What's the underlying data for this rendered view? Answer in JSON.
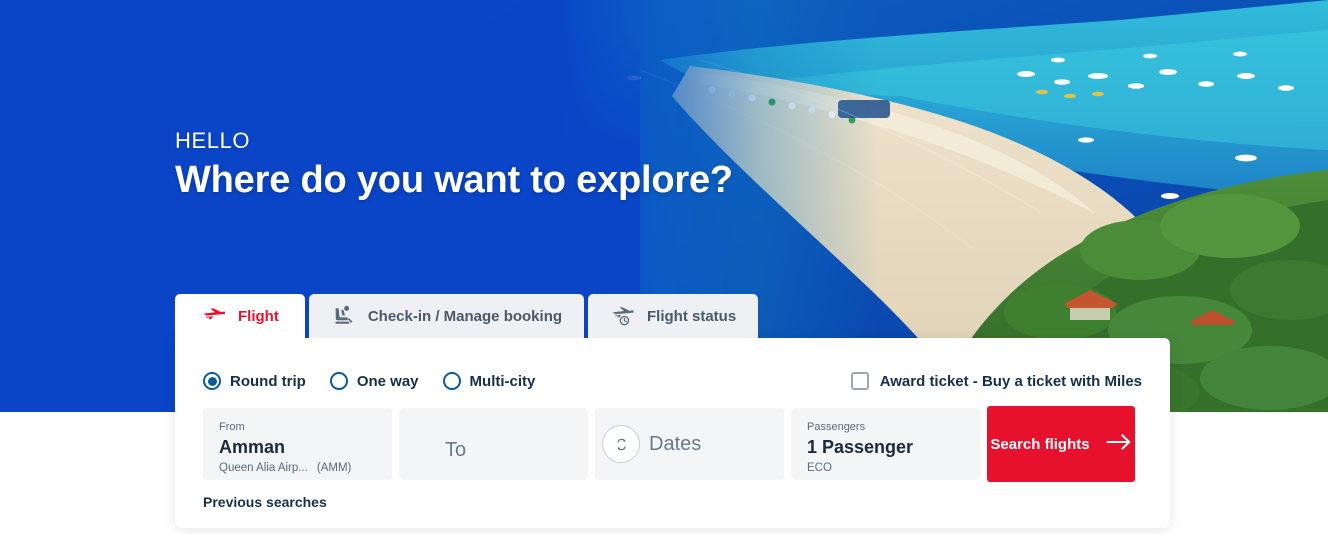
{
  "hero": {
    "greeting": "HELLO",
    "headline": "Where do you want to explore?",
    "overlay_color": "#0a45c8"
  },
  "tabs": [
    {
      "id": "flight",
      "label": "Flight",
      "icon": "airplane-icon",
      "active": true
    },
    {
      "id": "checkin",
      "label": "Check-in / Manage booking",
      "icon": "seat-icon",
      "active": false
    },
    {
      "id": "status",
      "label": "Flight status",
      "icon": "plane-clock-icon",
      "active": false
    }
  ],
  "search_panel": {
    "trip_types": [
      {
        "id": "round-trip",
        "label": "Round trip",
        "selected": true
      },
      {
        "id": "one-way",
        "label": "One way",
        "selected": false
      },
      {
        "id": "multi-city",
        "label": "Multi-city",
        "selected": false
      }
    ],
    "award_ticket": {
      "label": "Award ticket - Buy a ticket with Miles",
      "checked": false
    },
    "from": {
      "label": "From",
      "city": "Amman",
      "airport": "Queen Alia Airp...",
      "code": "(AMM)"
    },
    "swap_icon": "swap-icon",
    "to": {
      "placeholder": "To",
      "value": ""
    },
    "dates": {
      "placeholder": "Dates",
      "icon": "calendar-icon",
      "value": ""
    },
    "passengers": {
      "label": "Passengers",
      "value": "1 Passenger",
      "cabin": "ECO"
    },
    "search_button": {
      "label": "Search flights",
      "icon": "arrow-right-icon",
      "color": "#e8112d"
    },
    "previous_searches": "Previous searches"
  }
}
